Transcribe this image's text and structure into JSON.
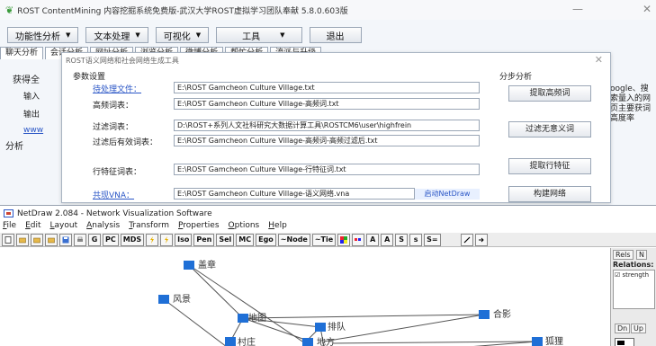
{
  "rost": {
    "title": "ROST ContentMining 内容挖掘系统免费版-武汉大学ROST虚拟学习团队奉献 5.8.0.603版",
    "menu": [
      {
        "label": "功能性分析"
      },
      {
        "label": "文本处理"
      },
      {
        "label": "可视化"
      },
      {
        "label": "工具"
      },
      {
        "label": "退出"
      }
    ],
    "tabs": [
      "聊天分析",
      "会话分析",
      "网址分析",
      "浏览分析",
      "微博分析",
      "帮忙分析",
      "流派与升级"
    ],
    "left_panel": {
      "group1": "获得全",
      "input_label": "输入",
      "output_label": "输出",
      "link": "www",
      "group2": "分析"
    },
    "right_text": "oogle、搜索量入的网页主要获词高度率"
  },
  "dialog": {
    "title": "ROST语义网络和社会网络生成工具",
    "param_header": "参数设置",
    "step_header": "分步分析",
    "rows": [
      {
        "label": "待处理文件：",
        "value": "E:\\ROST Gamcheon Culture Village.txt",
        "link": true
      },
      {
        "label": "高频词表：",
        "value": "E:\\ROST Gamcheon Culture Village-高频词.txt",
        "link": false
      },
      {
        "label": "过滤词表：",
        "value": "D:\\ROST+系列人文社科研究大数据计算工具\\ROSTCM6\\user\\highfrein",
        "link": false
      },
      {
        "label": "过滤后有效词表：",
        "value": "E:\\ROST Gamcheon Culture Village-高频词-高频过滤后.txt",
        "link": false
      },
      {
        "label": "行特征词表：",
        "value": "E:\\ROST Gamcheon Culture Village-行特征词.txt",
        "link": false
      },
      {
        "label": "共现VNA：",
        "value": "E:\\ROST Gamcheon Culture Village-语义网络.vna",
        "link": true
      }
    ],
    "buttons": {
      "extract_high_freq": "提取高频词",
      "filter_useless": "过滤无意义词",
      "extract_row_features": "提取行特征",
      "build_network": "构建网络"
    },
    "launch_netdraw": "启动NetDraw"
  },
  "netdraw": {
    "title": "NetDraw 2.084 - Network Visualization Software",
    "menu": [
      "File",
      "Edit",
      "Layout",
      "Analysis",
      "Transform",
      "Properties",
      "Options",
      "Help"
    ],
    "toolbar_text": [
      "G",
      "PC",
      "MDS",
      "Iso",
      "Pen",
      "Sel",
      "MC",
      "Ego",
      "~Node",
      "~Tie",
      "A",
      "A",
      "S",
      "s",
      "S="
    ],
    "side": {
      "tab1": "Rels",
      "tab2": "N",
      "relations_label": "Relations:",
      "relation_item": "strength",
      "dn": "Dn",
      "up": "Up"
    },
    "node_color": "#1f6fd6",
    "nodes": [
      {
        "label": "盖章"
      },
      {
        "label": "风景"
      },
      {
        "label": "地图"
      },
      {
        "label": "排队"
      },
      {
        "label": "合影"
      },
      {
        "label": "村庄"
      },
      {
        "label": "地方"
      },
      {
        "label": "狐狸"
      }
    ]
  }
}
